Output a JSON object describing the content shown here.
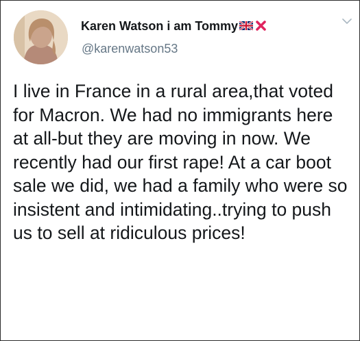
{
  "tweet": {
    "author": {
      "name": "Karen Watson i am Tommy",
      "handle": "@karenwatson53",
      "avatar_icon": "profile-photo",
      "name_suffix_icons": [
        "uk-flag-icon",
        "red-cross-icon"
      ]
    },
    "text": "I live in France in a rural area,that voted for Macron. We had no immigrants here at all-but they are moving in now. We recently had our first rape! At a car boot sale we did, we had a family who were so insistent and intimidating..trying to push us to sell at ridiculous prices!",
    "menu_icon": "chevron-down-icon"
  },
  "colors": {
    "name": "#14171a",
    "handle": "#657786",
    "cross": "#e0245e",
    "chevron": "#aab8c2"
  }
}
